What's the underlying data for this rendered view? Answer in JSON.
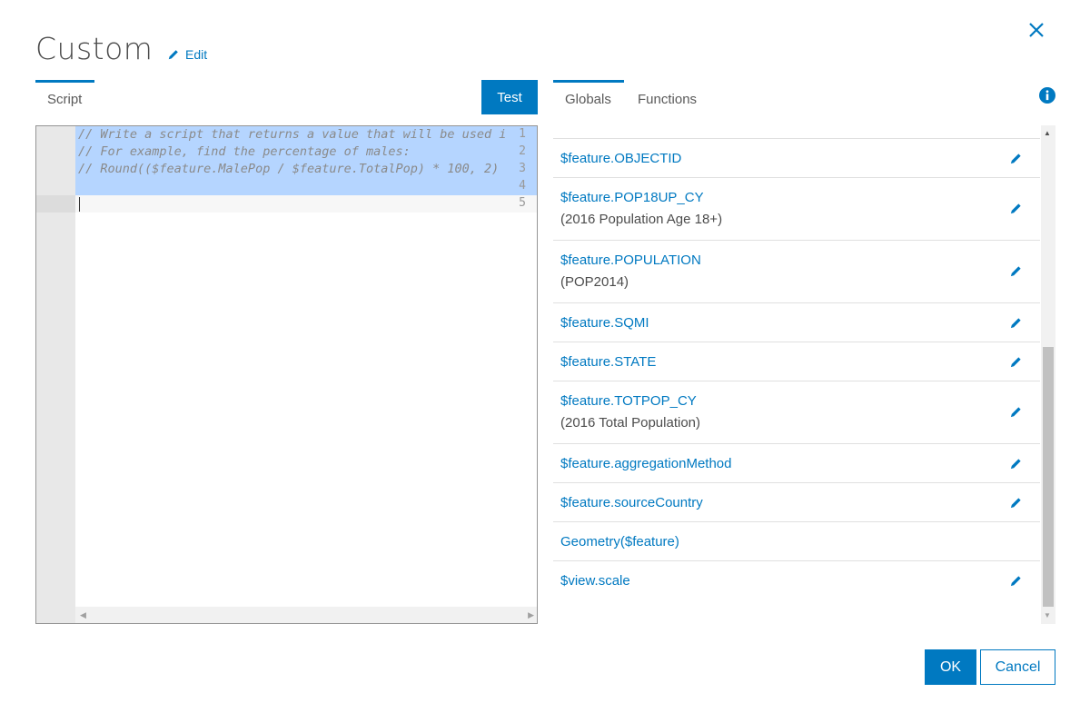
{
  "dialog": {
    "title": "Custom",
    "edit_label": "Edit"
  },
  "tabs": {
    "script": "Script",
    "globals": "Globals",
    "functions": "Functions"
  },
  "toolbar": {
    "test_label": "Test"
  },
  "editor": {
    "line_numbers": [
      "1",
      "2",
      "3",
      "4",
      "5"
    ],
    "lines": [
      "// Write a script that returns a value that will be used i",
      "// For example, find the percentage of males:",
      "// Round(($feature.MalePop / $feature.TotalPop) * 100, 2)",
      "",
      ""
    ]
  },
  "globals": {
    "items": [
      {
        "name": "$feature.OBJECTID",
        "desc": ""
      },
      {
        "name": "$feature.POP18UP_CY",
        "desc": "(2016 Population Age 18+)"
      },
      {
        "name": "$feature.POPULATION",
        "desc": "(POP2014)"
      },
      {
        "name": "$feature.SQMI",
        "desc": ""
      },
      {
        "name": "$feature.STATE",
        "desc": ""
      },
      {
        "name": "$feature.TOTPOP_CY",
        "desc": "(2016 Total Population)"
      },
      {
        "name": "$feature.aggregationMethod",
        "desc": ""
      },
      {
        "name": "$feature.sourceCountry",
        "desc": ""
      },
      {
        "name": "Geometry($feature)",
        "desc": ""
      },
      {
        "name": "$view.scale",
        "desc": ""
      }
    ]
  },
  "footer": {
    "ok_label": "OK",
    "cancel_label": "Cancel"
  },
  "colors": {
    "accent": "#0079c1",
    "selection": "#b5d5ff"
  },
  "icons": {
    "close": "close-icon",
    "edit": "pencil-icon",
    "info": "info-icon"
  }
}
